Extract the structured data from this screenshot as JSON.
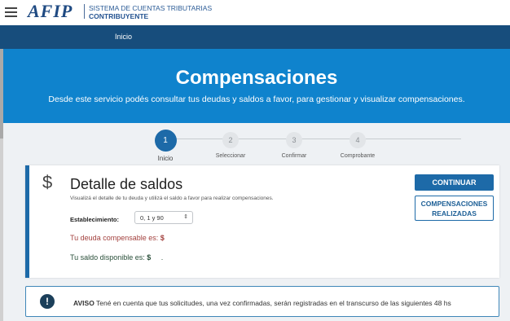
{
  "header": {
    "logo_text": "AFIP",
    "system_title": "SISTEMA DE CUENTAS TRIBUTARIAS",
    "system_subtitle": "CONTRIBUYENTE"
  },
  "nav": {
    "home_label": "Inicio"
  },
  "hero": {
    "title": "Compensaciones",
    "subtitle": "Desde este servicio podés consultar tus deudas y saldos a favor, para gestionar y visualizar compensaciones."
  },
  "steps": [
    {
      "number": "1",
      "label": "Inicio",
      "active": true
    },
    {
      "number": "2",
      "label": "Seleccionar",
      "active": false
    },
    {
      "number": "3",
      "label": "Confirmar",
      "active": false
    },
    {
      "number": "4",
      "label": "Comprobante",
      "active": false
    }
  ],
  "card": {
    "icon": "dollar-icon",
    "title": "Detalle de saldos",
    "description": "Visualizá el detalle de tu deuda y utilizá el saldo a favor para realizar compensaciones.",
    "establishment_label": "Establecimiento:",
    "establishment_value": "0, 1 y 90",
    "debt_label": "Tu deuda compensable es:",
    "debt_currency": "$",
    "balance_label": "Tu saldo disponible es:",
    "balance_currency": "$",
    "balance_value": ".",
    "continue_label": "CONTINUAR",
    "compensations_label_line1": "COMPENSACIONES",
    "compensations_label_line2": "REALIZADAS"
  },
  "notice": {
    "icon": "exclamation-icon",
    "title": "AVISO",
    "text": "Tené en cuenta que tus solicitudes, una vez confirmadas, serán registradas en el transcurso de las siguientes 48 hs"
  },
  "colors": {
    "nav": "#174d7c",
    "hero": "#0f83cd",
    "primary": "#1d6aa8",
    "debt_text": "#a3413e"
  }
}
